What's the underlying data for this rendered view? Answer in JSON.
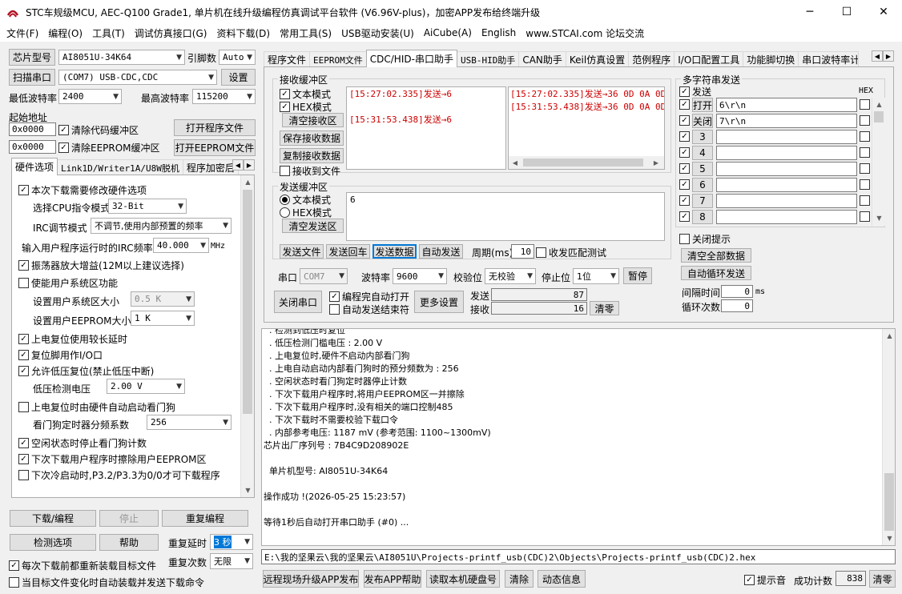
{
  "window": {
    "title": "STC车规级MCU, AEC-Q100 Grade1, 单片机在线升级编程仿真调试平台软件 (V6.96V-plus)，加密APP发布给终端升级",
    "minimize": "─",
    "maximize": "☐",
    "close": "✕"
  },
  "menu": [
    "文件(F)",
    "编程(O)",
    "工具(T)",
    "调试仿真接口(G)",
    "资料下载(D)",
    "常用工具(S)",
    "USB驱动安装(U)",
    "AiCube(A)",
    "English",
    "www.STCAI.com 论坛交流"
  ],
  "left": {
    "chip_label": "芯片型号",
    "chip_value": "AI8051U-34K64",
    "pins_label": "引脚数",
    "pins_value": "Auto",
    "scan_button": "扫描串口",
    "port_value": "(COM7) USB-CDC,CDC",
    "settings_button": "设置",
    "min_baud_label": "最低波特率",
    "min_baud_value": "2400",
    "max_baud_label": "最高波特率",
    "max_baud_value": "115200",
    "start_addr_label": "起始地址",
    "addr1": "0x0000",
    "clear_code_label": "清除代码缓冲区",
    "open_prog_button": "打开程序文件",
    "addr2": "0x0000",
    "clear_eeprom_label": "清除EEPROM缓冲区",
    "open_eeprom_button": "打开EEPROM文件",
    "tabs": [
      "硬件选项",
      "Link1D/Writer1A/U8W脱机",
      "程序加密后"
    ],
    "hw": {
      "modify_hw": "本次下载需要修改硬件选项",
      "cpu_label": "选择CPU指令模式",
      "cpu_value": "32-Bit",
      "irc_label": "IRC调节模式",
      "irc_value": "不调节,使用内部预置的频率",
      "freq_label": "输入用户程序运行时的IRC频率",
      "freq_value": "40.000",
      "freq_unit": "MHz",
      "osc_gain": "振荡器放大增益(12M以上建议选择)",
      "user_sys": "使能用户系统区功能",
      "sys_size_label": "设置用户系统区大小",
      "sys_size_value": "0.5 K",
      "eeprom_size_label": "设置用户EEPROM大小",
      "eeprom_size_value": "1  K",
      "power_delay": "上电复位使用较长延时",
      "reset_pin": "复位脚用作I/O口",
      "lvd_reset": "允许低压复位(禁止低压中断)",
      "lvd_label": "低压检测电压",
      "lvd_value": "2.00 V",
      "wdt_start": "上电复位时由硬件自动启动看门狗",
      "wdt_div_label": "看门狗定时器分频系数",
      "wdt_div_value": "256",
      "idle_wdt": "空闲状态时停止看门狗计数",
      "erase_eeprom": "下次下载用户程序时擦除用户EEPROM区",
      "cold_boot": "下次冷启动时,P3.2/P3.3为0/0才可下载程序"
    },
    "download_button": "下载/编程",
    "stop_button": "停止",
    "reprogram_button": "重复编程",
    "detect_button": "检测选项",
    "help_button": "帮助",
    "repeat_delay_label": "重复延时",
    "repeat_delay_value": "3 秒",
    "repeat_count_label": "重复次数",
    "repeat_count_value": "无限",
    "reload_before": "每次下载前都重新装载目标文件",
    "auto_send_change": "当目标文件变化时自动装载并发送下载命令"
  },
  "right_tabs": [
    "程序文件",
    "EEPROM文件",
    "CDC/HID-串口助手",
    "USB-HID助手",
    "CAN助手",
    "Keil仿真设置",
    "范例程序",
    "I/O口配置工具",
    "功能脚切换",
    "串口波特率计"
  ],
  "recv": {
    "group": "接收缓冲区",
    "text_mode": "文本模式",
    "hex_mode": "HEX模式",
    "clear_button": "清空接收区",
    "save_button": "保存接收数据",
    "copy_button": "复制接收数据",
    "to_file": "接收到文件",
    "lines_left": [
      "[15:27:02.335]发送→6",
      "",
      "",
      "",
      "[15:31:53.438]发送→6"
    ],
    "lines_right": [
      "[15:27:02.335]发送→36 0D 0A 0D",
      "[15:31:53.438]发送→36 0D 0A 0D"
    ]
  },
  "send": {
    "group": "发送缓冲区",
    "text_mode": "文本模式",
    "hex_mode": "HEX模式",
    "clear_button": "清空发送区",
    "content": "6",
    "send_file": "发送文件",
    "send_enter": "发送回车",
    "send_data": "发送数据",
    "auto_send": "自动发送",
    "period_label": "周期(ms)",
    "period_value": "10",
    "match_test": "收发匹配测试"
  },
  "serial": {
    "port_label": "串口",
    "port_value": "COM7",
    "baud_label": "波特率",
    "baud_value": "9600",
    "parity_label": "校验位",
    "parity_value": "无校验",
    "stop_label": "停止位",
    "stop_value": "1位",
    "pause_button": "暂停",
    "close_button": "关闭串口",
    "auto_open": "编程完自动打开",
    "auto_send_end": "自动发送结束符",
    "more_settings": "更多设置",
    "sent_label": "发送",
    "sent_value": "87",
    "recv_label": "接收",
    "recv_value": "16",
    "clear_button": "清零"
  },
  "multi": {
    "group": "多字符串发送",
    "send_label": "发送",
    "hex_label": "HEX",
    "rows": [
      {
        "btn": "打开",
        "text": "6\\r\\n"
      },
      {
        "btn": "关闭",
        "text": "7\\r\\n"
      },
      {
        "btn": "3",
        "text": ""
      },
      {
        "btn": "4",
        "text": ""
      },
      {
        "btn": "5",
        "text": ""
      },
      {
        "btn": "6",
        "text": ""
      },
      {
        "btn": "7",
        "text": ""
      },
      {
        "btn": "8",
        "text": ""
      }
    ],
    "close_tip": "关闭提示",
    "clear_all": "清空全部数据",
    "auto_loop": "自动循环发送",
    "interval_label": "间隔时间",
    "interval_value": "0",
    "interval_unit": "ms",
    "loop_label": "循环次数",
    "loop_value": "0"
  },
  "log": [
    "  . 检测到低压时复位",
    "  . 低压检测门槛电压 : 2.00 V",
    "  . 上电复位时,硬件不启动内部看门狗",
    "  . 上电自动启动内部看门狗时的预分频数为 : 256",
    "  . 空闲状态时看门狗定时器停止计数",
    "  . 下次下载用户程序时,将用户EEPROM区一并擦除",
    "  . 下次下载用户程序时,没有相关的端口控制485",
    "  . 下次下载时不需要校验下载口令",
    "  . 内部参考电压: 1187 mV (参考范围: 1100~1300mV)",
    "芯片出厂序列号 : 7B4C9D208902E",
    "",
    "  单片机型号: AI8051U-34K64",
    "",
    "操作成功 !(2026-05-25 15:23:57)",
    "",
    "等待1秒后自动打开串口助手 (#0) ..."
  ],
  "status": {
    "path": "E:\\我的坚果云\\我的坚果云\\AI8051U\\Projects-printf_usb(CDC)2\\Objects\\Projects-printf_usb(CDC)2.hex",
    "remote_upgrade": "远程现场升级APP发布",
    "publish_help": "发布APP帮助",
    "read_disk": "读取本机硬盘号",
    "clear": "清除",
    "dynamic_info": "动态信息",
    "beep_label": "提示音",
    "success_label": "成功计数",
    "success_value": "838",
    "clear_count": "清零"
  }
}
